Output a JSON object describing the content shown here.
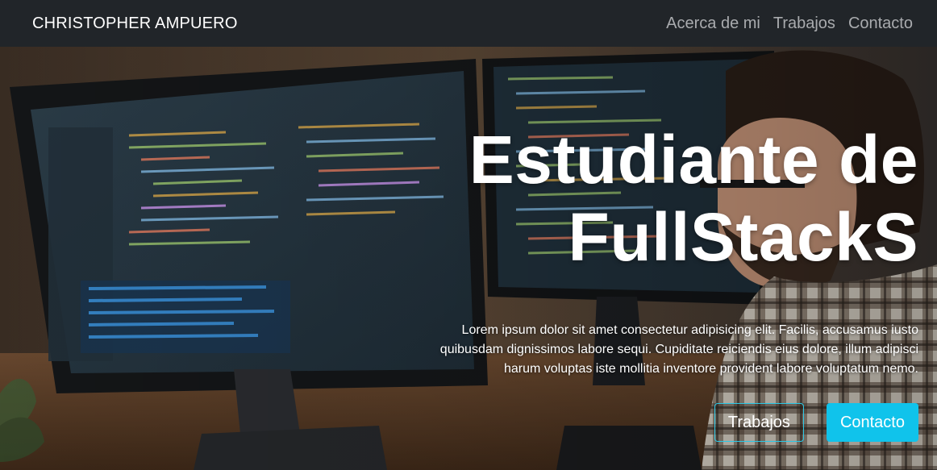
{
  "navbar": {
    "brand": "CHRISTOPHER AMPUERO",
    "links": [
      {
        "label": "Acerca de mi"
      },
      {
        "label": "Trabajos"
      },
      {
        "label": "Contacto"
      }
    ]
  },
  "hero": {
    "title_line1": "Estudiante de",
    "title_line2": "FullStackS",
    "description": "Lorem ipsum dolor sit amet consectetur adipisicing elit. Facilis, accusamus iusto quibusdam dignissimos labore sequi. Cupiditate reiciendis eius dolore, illum adipisci harum voluptas iste mollitia inventore provident labore voluptatum nemo.",
    "buttons": {
      "works": "Trabajos",
      "contact": "Contacto"
    },
    "image_alt": "developer-at-monitors-photo"
  },
  "colors": {
    "navbar_bg": "#212529",
    "accent": "#10c3eb",
    "nav_link": "#a9abae"
  }
}
